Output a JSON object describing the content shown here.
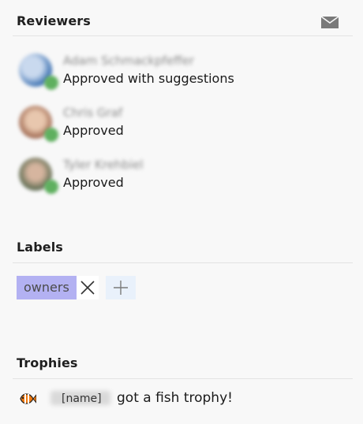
{
  "reviewers_section": {
    "title": "Reviewers",
    "mail_icon": "mail-icon",
    "items": [
      {
        "name": "Adam Schmackpfeffer",
        "status": "Approved with suggestions",
        "avatar_color": "#3a6fb0",
        "badge_color": "#5fb05f"
      },
      {
        "name": "Chris Graf",
        "status": "Approved",
        "avatar_color": "#b07a60",
        "badge_color": "#5fb05f"
      },
      {
        "name": "Tyler Krehbiel",
        "status": "Approved",
        "avatar_color": "#6a7f5a",
        "badge_color": "#5fb05f"
      }
    ]
  },
  "labels_section": {
    "title": "Labels",
    "labels": [
      {
        "text": "owners",
        "color": "#b3b1f2"
      }
    ],
    "remove_icon": "close-icon",
    "add_icon": "plus-icon"
  },
  "trophies_section": {
    "title": "Trophies",
    "icon": "fish-trophy-icon",
    "user_name": "[name]",
    "text": "got a fish trophy!"
  }
}
